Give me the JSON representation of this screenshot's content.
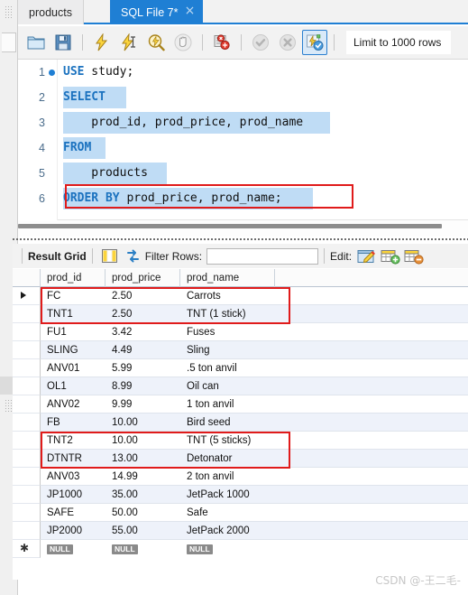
{
  "window": {
    "app": "MySQL Workbench SQL Editor"
  },
  "tabs": [
    {
      "label": "products",
      "active": false,
      "icon": ""
    },
    {
      "label": "SQL File 7*",
      "active": true,
      "icon": "close-icon",
      "close": "×"
    }
  ],
  "editor_toolbar": {
    "buttons": [
      {
        "name": "open-sql-file-button",
        "icon": "folder-icon"
      },
      {
        "name": "save-sql-file-button",
        "icon": "floppy-disk-icon"
      },
      {
        "name": "execute-statement-button",
        "icon": "lightning-bolt-icon"
      },
      {
        "name": "execute-current-statement-button",
        "icon": "lightning-bolt-cursor-icon"
      },
      {
        "name": "explain-query-button",
        "icon": "magnifier-lightning-icon"
      },
      {
        "name": "stop-query-button",
        "icon": "stop-hand-icon"
      },
      {
        "name": "toggle-breakpoint-button",
        "icon": "breakpoint-icon"
      },
      {
        "name": "commit-button",
        "icon": "check-circle-icon"
      },
      {
        "name": "rollback-button",
        "icon": "cross-circle-icon"
      },
      {
        "name": "toggle-autocommit-button",
        "icon": "autocommit-icon",
        "selected": true
      }
    ],
    "limit_dropdown": "Limit to 1000 rows"
  },
  "sql": {
    "lines": [
      {
        "num": "1",
        "breakpoint": true,
        "sel_width": 0,
        "indent": 0,
        "segments": [
          {
            "text": "USE",
            "kw": true
          },
          {
            "text": " study;",
            "kw": false
          }
        ]
      },
      {
        "num": "2",
        "breakpoint": false,
        "sel_width": 70,
        "indent": 0,
        "segments": [
          {
            "text": "SELECT",
            "kw": true
          }
        ]
      },
      {
        "num": "3",
        "breakpoint": false,
        "sel_width": 296,
        "indent": 0,
        "segments": [
          {
            "text": "    prod_id, prod_price, prod_name",
            "kw": false
          }
        ]
      },
      {
        "num": "4",
        "breakpoint": false,
        "sel_width": 47,
        "indent": 0,
        "segments": [
          {
            "text": "FROM",
            "kw": true
          }
        ]
      },
      {
        "num": "5",
        "breakpoint": false,
        "sel_width": 115,
        "indent": 0,
        "segments": [
          {
            "text": "    products",
            "kw": false
          }
        ]
      },
      {
        "num": "6",
        "breakpoint": false,
        "sel_width": 277,
        "indent": 0,
        "segments": [
          {
            "text": "ORDER BY",
            "kw": true
          },
          {
            "text": " prod_price, prod_name;",
            "kw": false
          }
        ]
      }
    ]
  },
  "result_toolbar": {
    "title": "Result Grid",
    "grid_view_icon": "grid-view-icon",
    "refresh_icon": "refresh-icon",
    "filter_label": "Filter Rows:",
    "filter_value": "",
    "filter_placeholder": "",
    "edit_label": "Edit:",
    "edit_buttons": [
      {
        "name": "edit-row-button",
        "icon": "pencil-grid-icon"
      },
      {
        "name": "insert-row-button",
        "icon": "grid-plus-icon"
      },
      {
        "name": "delete-row-button",
        "icon": "grid-minus-icon"
      }
    ]
  },
  "grid": {
    "columns": [
      "prod_id",
      "prod_price",
      "prod_name"
    ],
    "rows": [
      {
        "prod_id": "FC",
        "prod_price": "2.50",
        "prod_name": "Carrots"
      },
      {
        "prod_id": "TNT1",
        "prod_price": "2.50",
        "prod_name": "TNT (1 stick)"
      },
      {
        "prod_id": "FU1",
        "prod_price": "3.42",
        "prod_name": "Fuses"
      },
      {
        "prod_id": "SLING",
        "prod_price": "4.49",
        "prod_name": "Sling"
      },
      {
        "prod_id": "ANV01",
        "prod_price": "5.99",
        "prod_name": ".5 ton anvil"
      },
      {
        "prod_id": "OL1",
        "prod_price": "8.99",
        "prod_name": "Oil can"
      },
      {
        "prod_id": "ANV02",
        "prod_price": "9.99",
        "prod_name": "1 ton anvil"
      },
      {
        "prod_id": "FB",
        "prod_price": "10.00",
        "prod_name": "Bird seed"
      },
      {
        "prod_id": "TNT2",
        "prod_price": "10.00",
        "prod_name": "TNT (5 sticks)"
      },
      {
        "prod_id": "DTNTR",
        "prod_price": "13.00",
        "prod_name": "Detonator"
      },
      {
        "prod_id": "ANV03",
        "prod_price": "14.99",
        "prod_name": "2 ton anvil"
      },
      {
        "prod_id": "JP1000",
        "prod_price": "35.00",
        "prod_name": "JetPack 1000"
      },
      {
        "prod_id": "SAFE",
        "prod_price": "50.00",
        "prod_name": "Safe"
      },
      {
        "prod_id": "JP2000",
        "prod_price": "55.00",
        "prod_name": "JetPack 2000"
      }
    ],
    "new_row": {
      "prod_id": "NULL",
      "prod_price": "NULL",
      "prod_name": "NULL"
    },
    "selected_row_index": 0
  },
  "annotations": {
    "highlight_color": "#e01b1b",
    "boxes": [
      {
        "name": "order-by-clause-highlight",
        "target": "sql line 6"
      },
      {
        "name": "price-tie-highlight-1",
        "target": "rows FC / TNT1"
      },
      {
        "name": "price-tie-highlight-2",
        "target": "rows FB / TNT2"
      }
    ]
  },
  "watermark": "CSDN @-王二毛-"
}
